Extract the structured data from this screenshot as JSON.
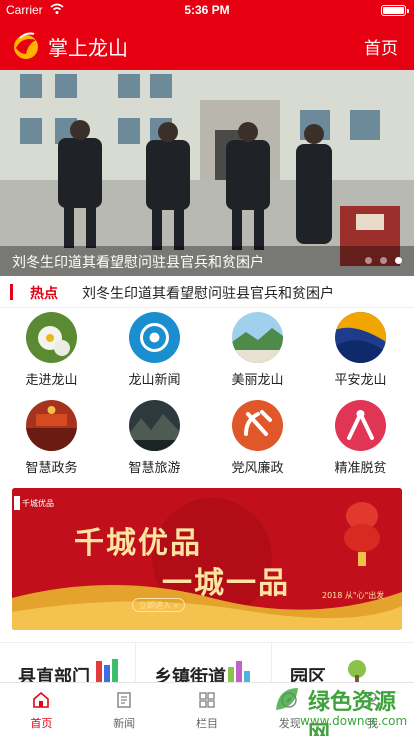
{
  "status_bar": {
    "carrier": "Carrier",
    "time": "5:36 PM"
  },
  "header": {
    "title": "掌上龙山",
    "home_link": "首页"
  },
  "banner": {
    "caption": "刘冬生印道其看望慰问驻县官兵和贫困户",
    "slide_count": 3,
    "active_slide": 3
  },
  "hot": {
    "label": "热点",
    "headline": "刘冬生印道其看望慰问驻县官兵和贫困户"
  },
  "grid": [
    {
      "label": "走进龙山",
      "icon": "flower-icon"
    },
    {
      "label": "龙山新闻",
      "icon": "camera-icon"
    },
    {
      "label": "美丽龙山",
      "icon": "landscape-icon"
    },
    {
      "label": "平安龙山",
      "icon": "wave-icon"
    },
    {
      "label": "智慧政务",
      "icon": "hall-icon"
    },
    {
      "label": "智慧旅游",
      "icon": "forest-icon"
    },
    {
      "label": "党风廉政",
      "icon": "party-emblem-icon"
    },
    {
      "label": "精准脱贫",
      "icon": "gift-icon"
    }
  ],
  "ad": {
    "brand_mark": "千城优品",
    "slogan_line1": "千城优品",
    "slogan_line2": "一城一品",
    "button": "立即进入 »",
    "tag": "2018 从\"心\"出发"
  },
  "quicklinks": [
    {
      "title": "县直部门"
    },
    {
      "title": "乡镇街道"
    },
    {
      "title": "园区"
    }
  ],
  "tabbar": [
    {
      "label": "首页",
      "icon": "home-icon",
      "active": true
    },
    {
      "label": "新闻",
      "icon": "news-icon",
      "active": false
    },
    {
      "label": "栏目",
      "icon": "columns-icon",
      "active": false
    },
    {
      "label": "发现",
      "icon": "discover-icon",
      "active": false
    },
    {
      "label": "我",
      "icon": "profile-icon",
      "active": false
    }
  ],
  "watermark": {
    "text": "绿色资源网",
    "url": "www.downcc.com"
  },
  "colors": {
    "brand_red": "#e60012",
    "gold": "#ffe3a3",
    "watermark_green": "#3da33a"
  }
}
